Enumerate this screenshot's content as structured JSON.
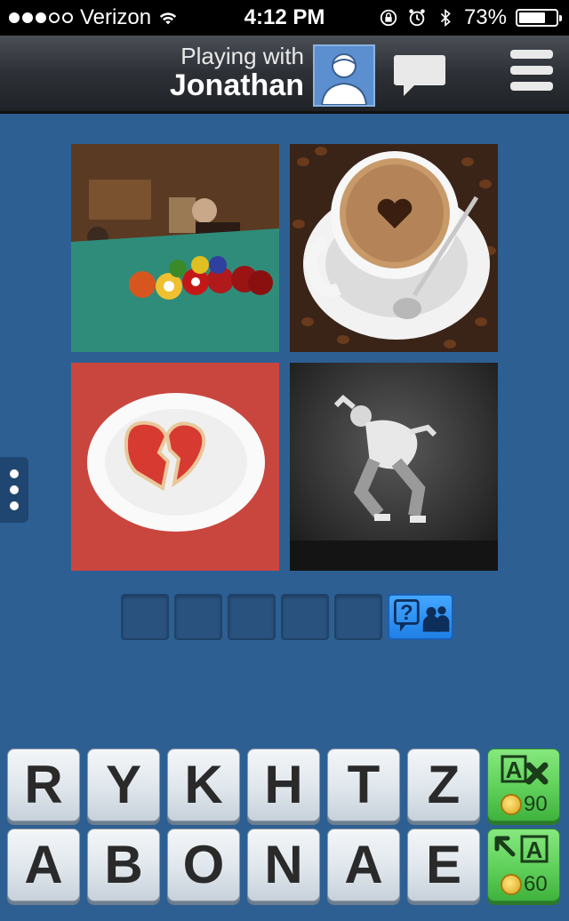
{
  "status_bar": {
    "carrier": "Verizon",
    "time": "4:12 PM",
    "battery": "73%",
    "battery_level": 0.73
  },
  "header": {
    "playing_with_label": "Playing with",
    "opponent_name": "Jonathan"
  },
  "puzzle": {
    "images": [
      {
        "name": "billiard-balls-photo"
      },
      {
        "name": "coffee-cup-photo"
      },
      {
        "name": "broken-heart-cookie-photo"
      },
      {
        "name": "jumping-dancer-photo"
      }
    ],
    "answer_slots": 5
  },
  "keyboard": {
    "row1": [
      "R",
      "Y",
      "K",
      "H",
      "T",
      "Z"
    ],
    "row2": [
      "A",
      "B",
      "O",
      "N",
      "A",
      "E"
    ]
  },
  "powerups": {
    "remove_letters": {
      "cost": "90"
    },
    "reveal_letter": {
      "cost": "60"
    }
  },
  "colors": {
    "background": "#2d5f93",
    "navbar": "#2d3036",
    "powerup_green": "#5fd05a",
    "help_blue": "#1e7fe6"
  }
}
